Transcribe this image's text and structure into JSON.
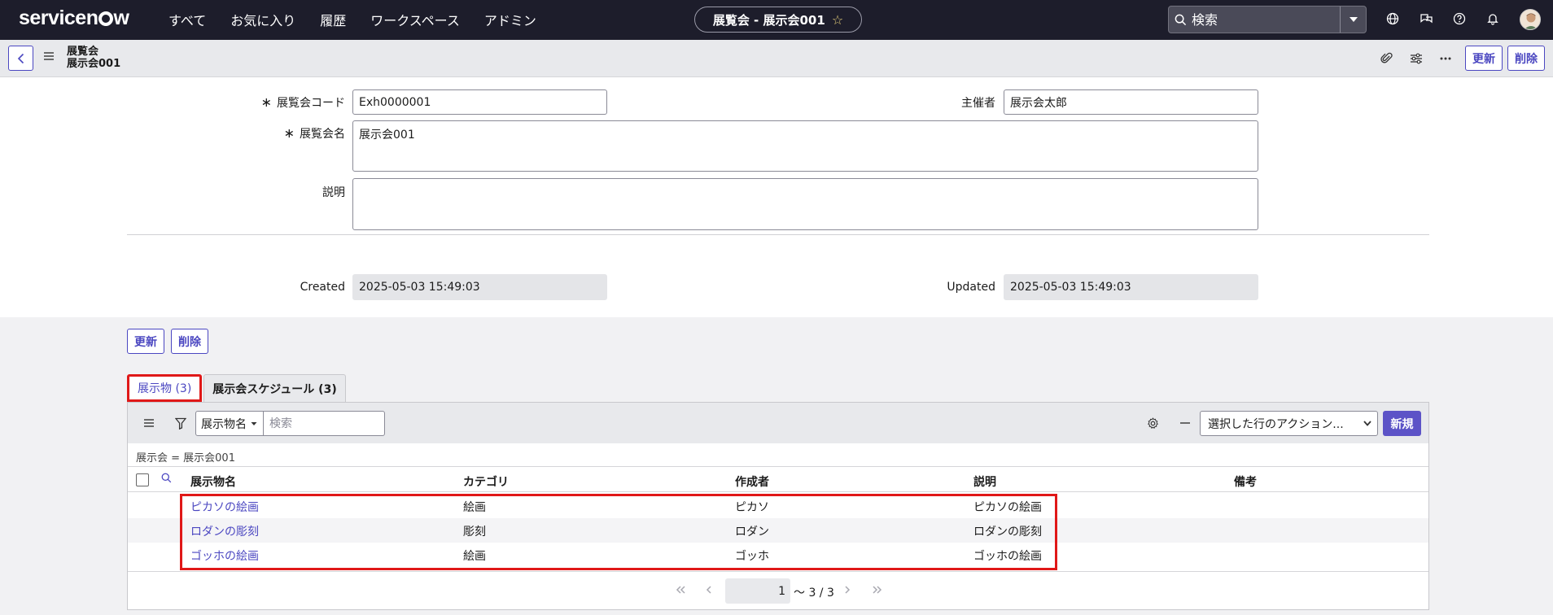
{
  "topnav": {
    "logo": "servicenow",
    "menu": [
      "すべて",
      "お気に入り",
      "履歴",
      "ワークスペース",
      "アドミン"
    ],
    "record_title": "展覧会 - 展示会001",
    "search_placeholder": "検索"
  },
  "header": {
    "line1": "展覧会",
    "line2": "展示会001",
    "update_label": "更新",
    "delete_label": "削除"
  },
  "form": {
    "code_label": "展覧会コード",
    "code_value": "Exh0000001",
    "organizer_label": "主催者",
    "organizer_value": "展示会太郎",
    "name_label": "展覧会名",
    "name_value": "展示会001",
    "desc_label": "説明",
    "desc_value": "",
    "created_label": "Created",
    "created_value": "2025-05-03 15:49:03",
    "updated_label": "Updated",
    "updated_value": "2025-05-03 15:49:03",
    "required_mark": "∗"
  },
  "bottom_buttons": {
    "update_label": "更新",
    "delete_label": "削除"
  },
  "tabs": [
    {
      "label": "展示物 (3)"
    },
    {
      "label": "展示会スケジュール (3)"
    }
  ],
  "list": {
    "field_select": "展示物名",
    "search_placeholder": "検索",
    "action_select": "選択した行のアクション...",
    "new_label": "新規",
    "breadcrumb": "展示会 = 展示会001",
    "columns": [
      "展示物名",
      "カテゴリ",
      "作成者",
      "説明",
      "備考"
    ],
    "rows": [
      {
        "name": "ピカソの絵画",
        "category": "絵画",
        "author": "ピカソ",
        "desc": "ピカソの絵画",
        "note": ""
      },
      {
        "name": "ロダンの彫刻",
        "category": "彫刻",
        "author": "ロダン",
        "desc": "ロダンの彫刻",
        "note": ""
      },
      {
        "name": "ゴッホの絵画",
        "category": "絵画",
        "author": "ゴッホ",
        "desc": "ゴッホの絵画",
        "note": ""
      }
    ],
    "page_value": "1",
    "page_text": "〜 3 / 3"
  }
}
